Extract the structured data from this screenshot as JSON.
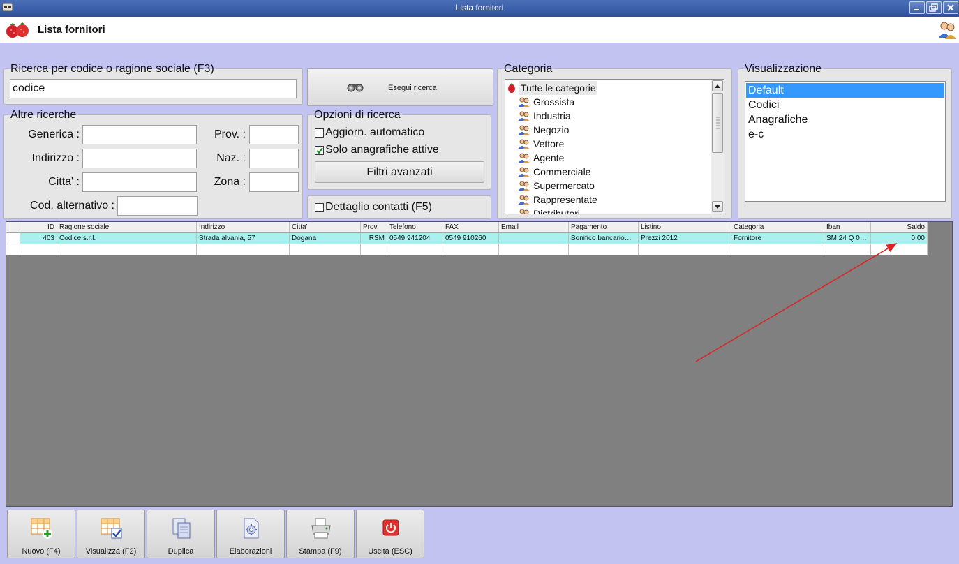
{
  "window": {
    "title": "Lista fornitori"
  },
  "header": {
    "title": "Lista fornitori"
  },
  "search": {
    "legend": "Ricerca per codice o ragione sociale (F3)",
    "value": "codice",
    "run_label": "Esegui ricerca"
  },
  "other_searches": {
    "legend": "Altre ricerche",
    "generica_label": "Generica :",
    "indirizzo_label": "Indirizzo :",
    "citta_label": "Citta' :",
    "cod_alt_label": "Cod. alternativo :",
    "prov_label": "Prov. :",
    "naz_label": "Naz. :",
    "zona_label": "Zona :"
  },
  "options": {
    "legend": "Opzioni di ricerca",
    "auto_update_label": "Aggiorn. automatico",
    "auto_update_checked": false,
    "active_only_label": "Solo anagrafiche attive",
    "active_only_checked": true,
    "advanced_filters_label": "Filtri avanzati"
  },
  "contact_detail": {
    "label": "Dettaglio contatti (F5)",
    "checked": false
  },
  "categories": {
    "legend": "Categoria",
    "all_label": "Tutte le categorie",
    "items": [
      "Grossista",
      "Industria",
      "Negozio",
      "Vettore",
      "Agente",
      "Commerciale",
      "Supermercato",
      "Rappresentate",
      "Distributori"
    ]
  },
  "view": {
    "legend": "Visualizzazione",
    "items": [
      "Default",
      "Codici",
      "Anagrafiche",
      "e-c"
    ],
    "selected": "Default"
  },
  "table": {
    "columns": [
      "ID",
      "Ragione sociale",
      "Indirizzo",
      "Citta'",
      "Prov.",
      "Telefono",
      "FAX",
      "Email",
      "Pagamento",
      "Listino",
      "Categoria",
      "Iban",
      "Saldo"
    ],
    "rows": [
      [
        "403",
        "Codice s.r.l.",
        "Strada alvania, 57",
        "Dogana",
        "RSM",
        "0549 941204",
        "0549 910260",
        "",
        "Bonifico bancario…",
        "Prezzi 2012",
        "Fornitore",
        "SM 24 Q 0…",
        "0,00"
      ]
    ]
  },
  "toolbar": {
    "new_label": "Nuovo (F4)",
    "view_label": "Visualizza (F2)",
    "duplicate_label": "Duplica",
    "process_label": "Elaborazioni",
    "print_label": "Stampa (F9)",
    "exit_label": "Uscita (ESC)"
  },
  "colors": {
    "selected_row": "#aaf0f0",
    "list_selection": "#3399ff",
    "annotation_arrow": "#e02020"
  }
}
